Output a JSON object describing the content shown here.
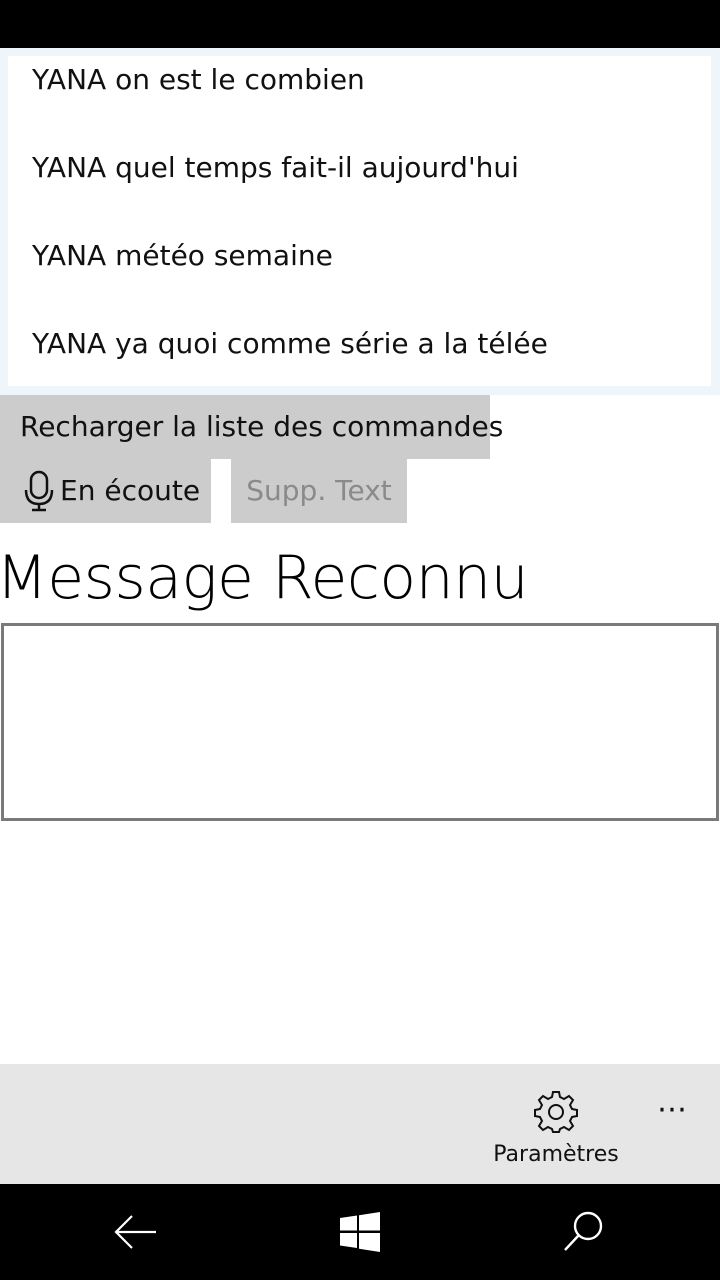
{
  "commands": {
    "items": [
      {
        "label": "YANA on est le combien"
      },
      {
        "label": "YANA quel temps fait-il aujourd'hui"
      },
      {
        "label": "YANA météo semaine"
      },
      {
        "label": "YANA ya quoi comme série a la télée"
      }
    ]
  },
  "buttons": {
    "reload_label": "Recharger la liste des commandes",
    "listen_label": "En écoute",
    "clear_label": "Supp. Text"
  },
  "recognized": {
    "title": "Message Reconnu",
    "value": ""
  },
  "app_bar": {
    "settings_label": "Paramètres",
    "more_label": "⋯"
  },
  "icons": {
    "listen": "microphone-icon",
    "settings": "gear-icon",
    "back": "back-arrow-icon",
    "home": "windows-logo-icon",
    "search": "search-icon"
  },
  "colors": {
    "button_bg": "#cccccc",
    "app_bar_bg": "#e6e6e6",
    "disabled_text": "#8a8a8a",
    "list_frame": "#eef6fc"
  }
}
